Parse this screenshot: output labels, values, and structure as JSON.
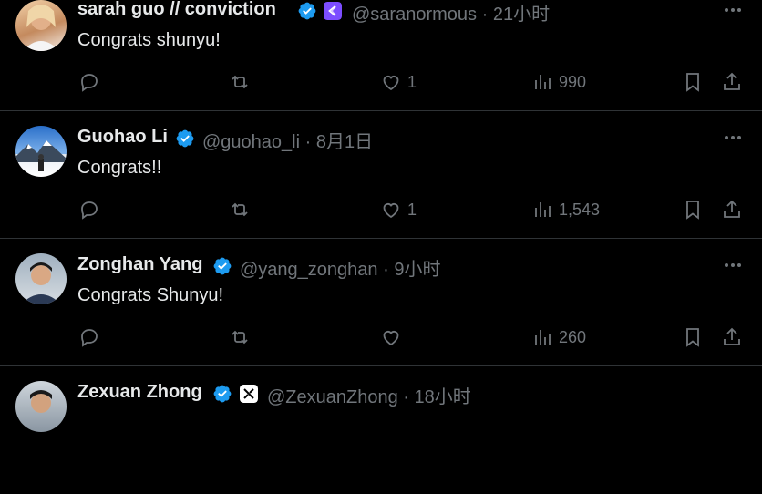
{
  "colors": {
    "background": "#000000",
    "text": "#e7e9ea",
    "muted": "#71767b",
    "divider": "#2f3336",
    "verified": "#1d9bf0",
    "conviction_badge": "#7c4dff"
  },
  "tweets": [
    {
      "name": "sarah guo // conviction",
      "handle": "@saranormous",
      "sep": "·",
      "time": "21小时",
      "text": "Congrats shunyu!",
      "likes": "1",
      "views": "990",
      "affiliate_icon": "conviction-badge-icon"
    },
    {
      "name": "Guohao Li",
      "handle": "@guohao_li",
      "sep": "·",
      "time": "8月1日",
      "text": "Congrats!!",
      "likes": "1",
      "views": "1,543"
    },
    {
      "name": "Zonghan Yang",
      "handle": "@yang_zonghan",
      "sep": "·",
      "time": "9小时",
      "text": "Congrats Shunyu!",
      "likes": "",
      "views": "260"
    },
    {
      "name": "Zexuan Zhong",
      "handle": "@ZexuanZhong",
      "sep": "·",
      "time": "18小时",
      "affiliate_icon": "xai-badge-icon"
    }
  ]
}
